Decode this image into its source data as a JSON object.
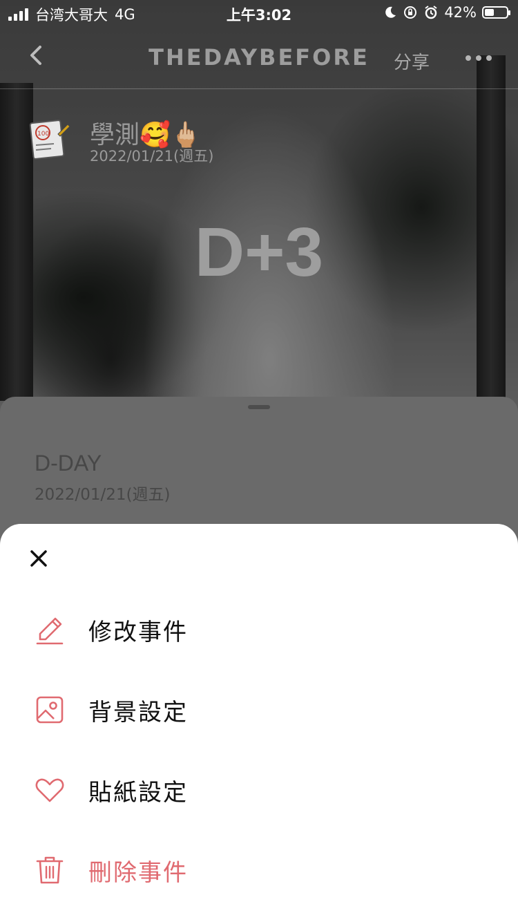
{
  "status_bar": {
    "carrier": "台湾大哥大",
    "network": "4G",
    "time": "上午3:02",
    "battery": "42%",
    "battery_level": 0.42
  },
  "nav": {
    "title": "THEDAYBEFORE",
    "share_label": "分享"
  },
  "event": {
    "name": "學測🥰🖕🏼",
    "date": "2022/01/21(週五)",
    "counter": "D+3"
  },
  "panel": {
    "dday_label": "D-DAY",
    "dday_date": "2022/01/21(週五)"
  },
  "sheet": {
    "items": [
      {
        "label": "修改事件",
        "icon": "pencil-icon"
      },
      {
        "label": "背景設定",
        "icon": "image-icon"
      },
      {
        "label": "貼紙設定",
        "icon": "heart-icon"
      },
      {
        "label": "刪除事件",
        "icon": "trash-icon"
      }
    ],
    "accent_color": "#e06a70"
  }
}
